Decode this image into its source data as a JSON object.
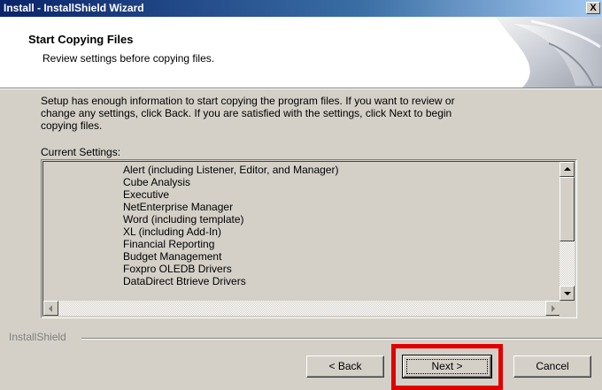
{
  "window": {
    "title": "Install - InstallShield Wizard",
    "close_label": "X"
  },
  "header": {
    "title": "Start Copying Files",
    "subtitle": "Review settings before copying files."
  },
  "body": {
    "description": "Setup has enough information to start copying the program files.  If you want to review or\nchange any settings, click Back.  If you are satisfied with the settings, click Next to begin\ncopying files.",
    "current_settings_label": "Current Settings:",
    "settings": [
      "Alert (including Listener, Editor, and Manager)",
      "Cube Analysis",
      "Executive",
      "NetEnterprise Manager",
      "Word (including template)",
      "XL (including Add-In)",
      "Financial Reporting",
      "Budget Management",
      "Foxpro OLEDB Drivers",
      "DataDirect Btrieve Drivers"
    ]
  },
  "footer": {
    "brand": "InstallShield",
    "back_label": "< Back",
    "next_label": "Next >",
    "cancel_label": "Cancel"
  },
  "annotation": {
    "highlight_color": "#e00000",
    "highlighted": "Next >"
  },
  "colors": {
    "dialog_face": "#d4d0c8",
    "title_start": "#0a246a",
    "title_end": "#a6caf0"
  },
  "icons": [
    "close-icon",
    "installer-graphic",
    "scroll-up-icon",
    "scroll-down-icon",
    "scroll-left-icon",
    "scroll-right-icon"
  ]
}
